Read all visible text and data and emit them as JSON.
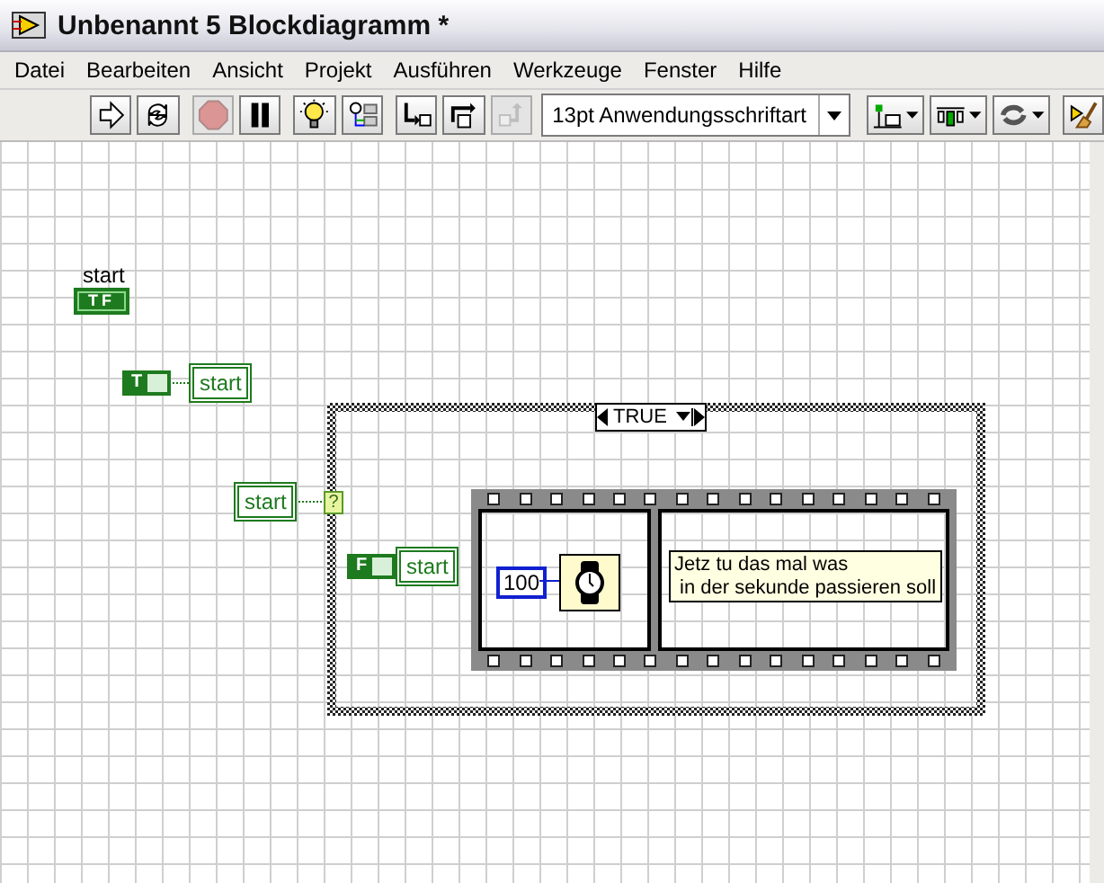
{
  "window": {
    "title": "Unbenannt 5 Blockdiagramm *"
  },
  "menu": [
    "Datei",
    "Bearbeiten",
    "Ansicht",
    "Projekt",
    "Ausführen",
    "Werkzeuge",
    "Fenster",
    "Hilfe"
  ],
  "toolbar": [
    {
      "kind": "run",
      "disabled": false
    },
    {
      "kind": "run-continuous",
      "disabled": false
    },
    {
      "kind": "abort",
      "disabled": true
    },
    {
      "kind": "pause",
      "disabled": false
    },
    {
      "kind": "highlight",
      "disabled": false
    },
    {
      "kind": "retain",
      "disabled": false
    },
    {
      "kind": "step-into",
      "disabled": false
    },
    {
      "kind": "step-over",
      "disabled": false
    },
    {
      "kind": "step-out",
      "disabled": true
    },
    {
      "kind": "font",
      "text": "13pt Anwendungsschriftart"
    },
    {
      "kind": "align",
      "disabled": false
    },
    {
      "kind": "distribute",
      "disabled": false
    },
    {
      "kind": "reorder",
      "disabled": false
    },
    {
      "kind": "cleanup",
      "disabled": false
    }
  ],
  "diagram": {
    "nodes": [
      {
        "kind": "label",
        "text": "start"
      },
      {
        "kind": "bool-control",
        "text": "TF"
      },
      {
        "kind": "bool-constant",
        "text": "T"
      },
      {
        "kind": "local-variable",
        "text": "start"
      },
      {
        "kind": "local-variable",
        "text": "start"
      }
    ],
    "case_structure": {
      "selector": "TRUE",
      "nodes": [
        {
          "kind": "selector-terminal",
          "text": "?"
        },
        {
          "kind": "bool-constant",
          "text": "F"
        },
        {
          "kind": "local-variable",
          "text": "start"
        }
      ],
      "sequence": {
        "frames": [
          {
            "nodes": [
              {
                "kind": "numeric-constant",
                "text": "100"
              },
              {
                "kind": "wait-function"
              }
            ]
          },
          {
            "nodes": [
              {
                "kind": "comment",
                "text": "Jetz tu das mal was\n in der sekunde passieren soll"
              }
            ]
          }
        ]
      }
    }
  }
}
